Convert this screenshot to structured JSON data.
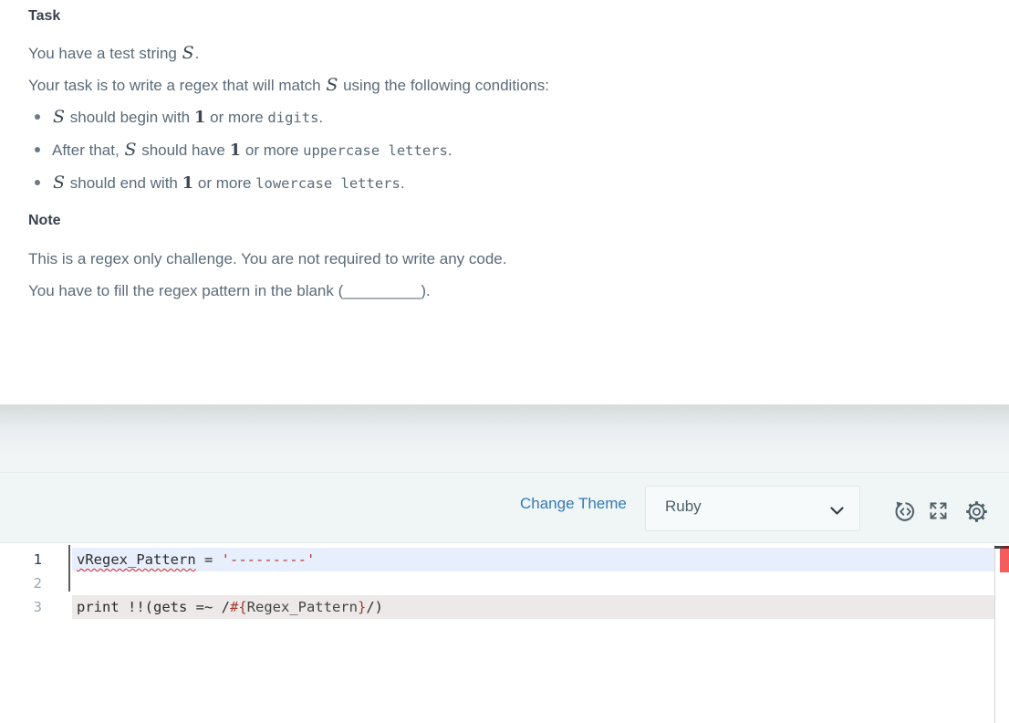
{
  "statement": {
    "task_heading": "Task",
    "p1": {
      "prefix": "You have a test string ",
      "s": "S",
      "suffix": "."
    },
    "p2": {
      "prefix": "Your task is to write a regex that will match ",
      "s": "S",
      "suffix": " using the following conditions:"
    },
    "bullets": [
      {
        "lead": "",
        "s": "S",
        "t1": " should begin with ",
        "n": "1",
        "t2": " or more ",
        "code": "digits",
        "t3": "."
      },
      {
        "lead": "After that, ",
        "s": "S",
        "t1": " should have ",
        "n": "1",
        "t2": " or more ",
        "code": "uppercase letters",
        "t3": "."
      },
      {
        "lead": "",
        "s": "S",
        "t1": " should end with ",
        "n": "1",
        "t2": " or more ",
        "code": "lowercase letters",
        "t3": "."
      }
    ],
    "note_heading": "Note",
    "note_p1": "This is a regex only challenge. You are not required to write any code.",
    "note_p2": {
      "prefix": "You have to fill the regex pattern in the blank (",
      "blank": "_________",
      "suffix": ")."
    }
  },
  "toolbar": {
    "change_theme_label": "Change Theme",
    "language_selected": "Ruby",
    "icons": [
      "chevron-down-icon",
      "reset-code-icon",
      "fullscreen-icon",
      "settings-gear-icon"
    ]
  },
  "editor": {
    "lines": [
      {
        "number": "1",
        "name": "vRegex_Pattern",
        "eq": " = ",
        "string": "'---------'"
      },
      {
        "number": "2"
      },
      {
        "number": "3",
        "seg1": "print !!(gets =~ /",
        "seg2": "#{",
        "seg3": "Regex_Pattern",
        "seg4": "}",
        "seg5": "/)"
      }
    ]
  },
  "colors": {
    "link_blue": "#337ab7",
    "string_red": "#b03830",
    "active_line_bg": "#e8effc",
    "executed_line_bg": "#ece9e8",
    "error_marker_red": "#f45d5d",
    "icon_slate": "#4e6069"
  }
}
